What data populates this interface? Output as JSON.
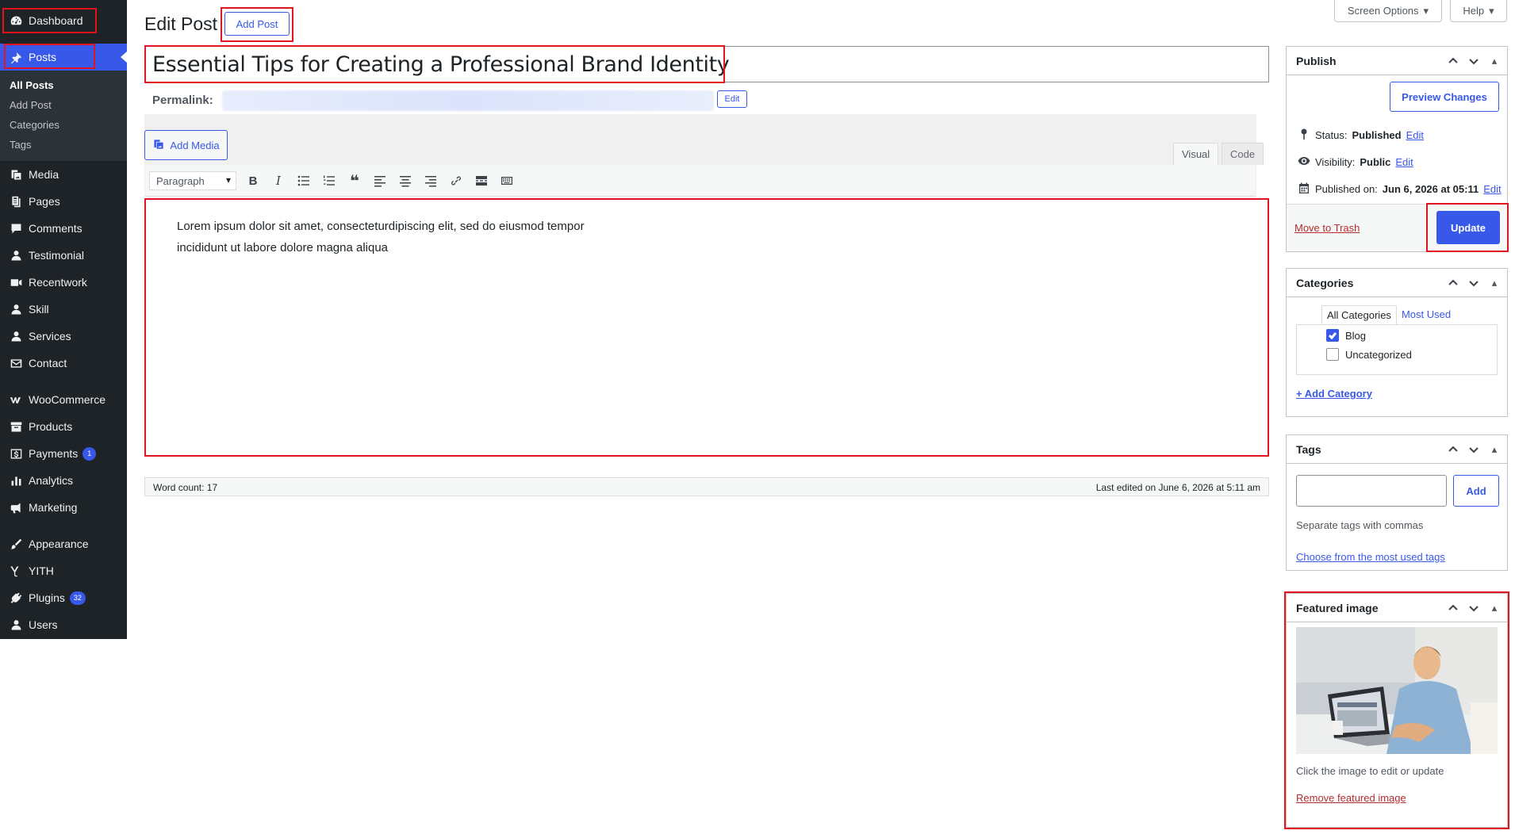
{
  "sidebar": {
    "dashboard": "Dashboard",
    "posts": "Posts",
    "submenu": [
      "All Posts",
      "Add Post",
      "Categories",
      "Tags"
    ],
    "items": [
      {
        "label": "Media",
        "icon": "media-icon"
      },
      {
        "label": "Pages",
        "icon": "pages-icon"
      },
      {
        "label": "Comments",
        "icon": "comments-icon"
      },
      {
        "label": "Testimonial",
        "icon": "user-icon"
      },
      {
        "label": "Recentwork",
        "icon": "video-icon"
      },
      {
        "label": "Skill",
        "icon": "user-icon"
      },
      {
        "label": "Services",
        "icon": "user-icon"
      },
      {
        "label": "Contact",
        "icon": "mail-icon"
      }
    ],
    "items2": [
      {
        "label": "WooCommerce",
        "icon": "woo-icon"
      },
      {
        "label": "Products",
        "icon": "archive-icon"
      },
      {
        "label": "Payments",
        "icon": "dollar-icon",
        "badge": "1"
      },
      {
        "label": "Analytics",
        "icon": "chart-icon"
      },
      {
        "label": "Marketing",
        "icon": "megaphone-icon"
      }
    ],
    "items3": [
      {
        "label": "Appearance",
        "icon": "brush-icon"
      },
      {
        "label": "YITH",
        "icon": "yith-icon"
      },
      {
        "label": "Plugins",
        "icon": "plugin-icon",
        "badge": "32"
      },
      {
        "label": "Users",
        "icon": "user-icon"
      }
    ]
  },
  "top": {
    "page_title": "Edit Post",
    "add_post": "Add Post",
    "screen_options": "Screen Options",
    "help": "Help"
  },
  "post": {
    "title": "Essential Tips for Creating a Professional Brand Identity",
    "permalink_label": "Permalink:",
    "permalink_edit": "Edit",
    "add_media": "Add Media",
    "tab_visual": "Visual",
    "tab_code": "Code",
    "format": "Paragraph",
    "content_line1": "Lorem ipsum dolor sit amet, consecteturdipiscing elit, sed do eiusmod tempor",
    "content_line2": "incididunt ut labore dolore magna aliqua",
    "word_count": "Word count: 17",
    "last_edited": "Last edited on June 6, 2026 at 5:11 am"
  },
  "publish": {
    "title": "Publish",
    "preview": "Preview Changes",
    "status_label": "Status:",
    "status_value": "Published",
    "visibility_label": "Visibility:",
    "visibility_value": "Public",
    "published_label": "Published on:",
    "published_value": "Jun 6, 2026 at 05:11",
    "edit": "Edit",
    "trash": "Move to Trash",
    "update": "Update"
  },
  "categories": {
    "title": "Categories",
    "tab_all": "All Categories",
    "tab_most": "Most Used",
    "items": [
      {
        "label": "Blog",
        "checked": true
      },
      {
        "label": "Uncategorized",
        "checked": false
      }
    ],
    "add": "+ Add Category"
  },
  "tags": {
    "title": "Tags",
    "add": "Add",
    "hint": "Separate tags with commas",
    "choose": "Choose from the most used tags"
  },
  "featured": {
    "title": "Featured image",
    "hint": "Click the image to edit or update",
    "remove": "Remove featured image"
  },
  "colors": {
    "sidebar_bg": "#1d2327",
    "accent": "#3858e9",
    "highlight": "#e0131f"
  }
}
